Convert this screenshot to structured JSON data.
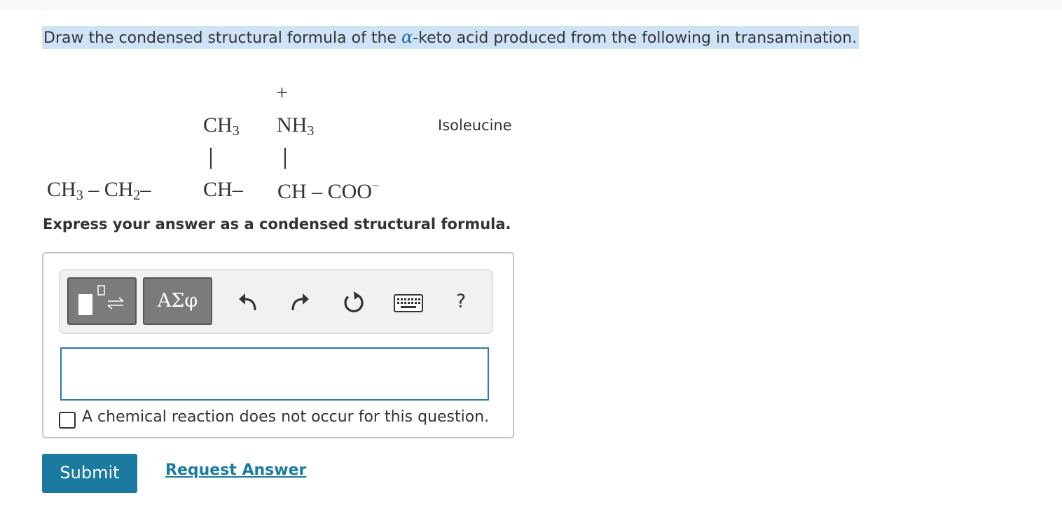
{
  "question": {
    "prefix": "Draw the condensed structural formula of the ",
    "alpha": "α",
    "suffix": "-keto acid produced from the following in transamination."
  },
  "structure": {
    "plus": "+",
    "branch1": {
      "main": "CH",
      "sub": "3"
    },
    "branch2": {
      "main": "NH",
      "sub": "3"
    },
    "chain": {
      "ch3": "CH",
      "ch3_sub": "3",
      "dash1": " – CH",
      "ch2_sub": "2",
      "dash2": "–",
      "ch": "CH–",
      "ch2": "CH – COO",
      "charge": "−"
    },
    "name": "Isoleucine"
  },
  "instruction": "Express your answer as a condensed structural formula.",
  "toolbar": {
    "templates_icon": "templates-icon",
    "greek_label": "ΑΣφ",
    "undo_icon": "undo-icon",
    "redo_icon": "redo-icon",
    "reset_icon": "reset-icon",
    "keyboard_icon": "keyboard-icon",
    "help_label": "?"
  },
  "answer": {
    "value": ""
  },
  "no_reaction_label": "A chemical reaction does not occur for this question.",
  "submit_label": "Submit",
  "request_label": "Request Answer",
  "colors": {
    "accent": "#1a7aa0",
    "highlight": "#cfe3f7",
    "input_border": "#2d7aa8",
    "button_gray": "#7b7b7b"
  }
}
